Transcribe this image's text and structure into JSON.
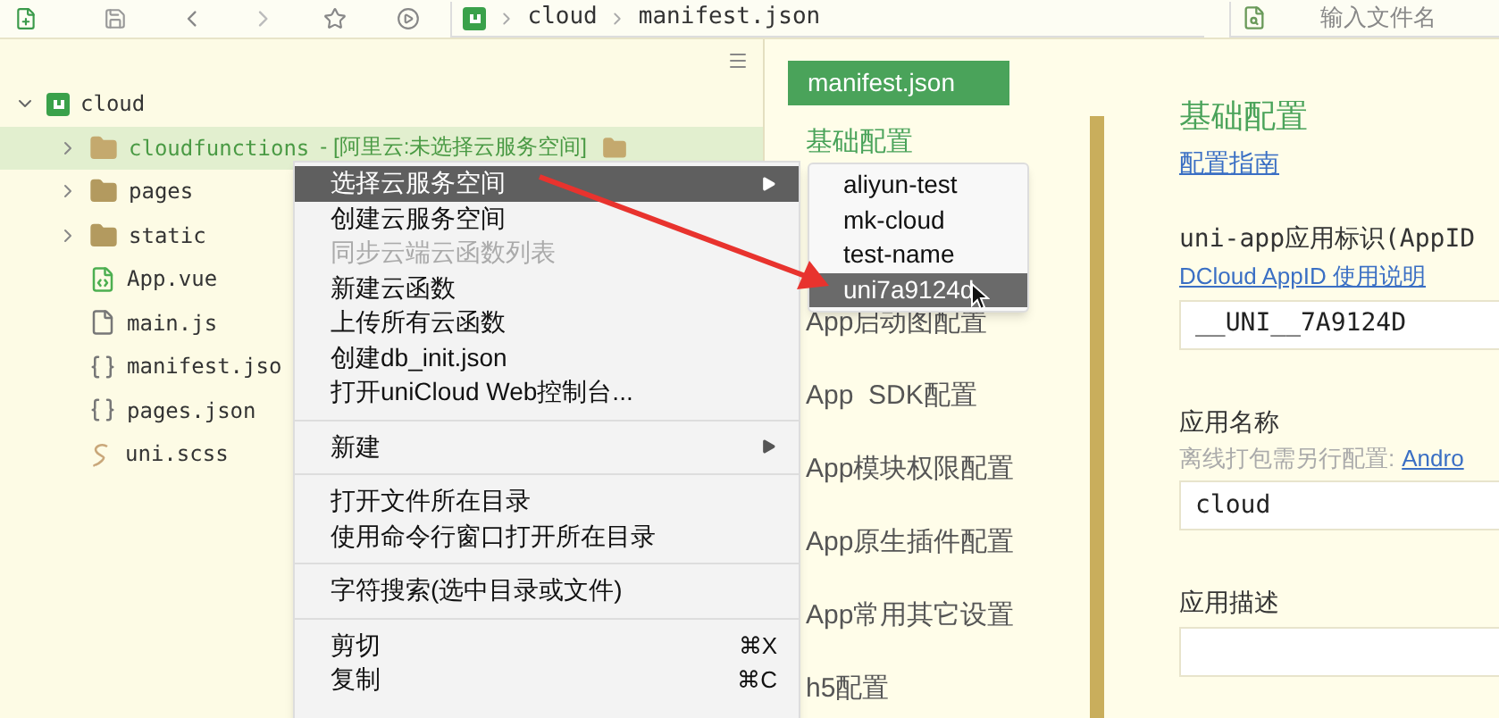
{
  "toolbar": {
    "breadcrumb": [
      "cloud",
      "manifest.json"
    ],
    "file_search": {
      "placeholder": "输入文件名"
    }
  },
  "project_tree": [
    {
      "label": "cloud",
      "kind": "project",
      "expanded": true,
      "selected": false,
      "children": [
        {
          "label": "cloudfunctions",
          "tag": "- [阿里云:未选择云服务空间]",
          "kind": "cloud-folder",
          "expanded": false,
          "selected": true
        },
        {
          "label": "pages",
          "kind": "folder",
          "expanded": false,
          "selected": false
        },
        {
          "label": "static",
          "kind": "folder",
          "expanded": false,
          "selected": false
        },
        {
          "label": "App.vue",
          "kind": "vue",
          "selected": false
        },
        {
          "label": "main.js",
          "kind": "js",
          "selected": false
        },
        {
          "label": "manifest.jso",
          "kind": "json",
          "selected": false
        },
        {
          "label": "pages.json",
          "kind": "json",
          "selected": false
        },
        {
          "label": "uni.scss",
          "kind": "scss",
          "selected": false
        }
      ]
    }
  ],
  "editor": {
    "tab": "manifest.json",
    "nav": [
      "基础配置",
      "App启动图配置",
      "App  SDK配置",
      "App模块权限配置",
      "App原生插件配置",
      "App常用其它设置",
      "h5配置"
    ],
    "title": "基础配置",
    "guide_link": "配置指南",
    "fields": [
      {
        "label": "uni-app应用标识(AppID",
        "link": "DCloud AppID 使用说明",
        "value": "__UNI__7A9124D"
      },
      {
        "label": "应用名称",
        "hint": "离线打包需另行配置:",
        "link": "Andro",
        "value": "cloud"
      },
      {
        "label": "应用描述"
      }
    ]
  },
  "context_menu": {
    "groups": [
      [
        {
          "label": "选择云服务空间",
          "submenu": true,
          "selected": true,
          "disabled": false
        },
        {
          "label": "创建云服务空间",
          "selected": false,
          "disabled": false
        },
        {
          "label": "同步云端云函数列表",
          "selected": false,
          "disabled": true
        },
        {
          "label": "新建云函数",
          "selected": false,
          "disabled": false
        },
        {
          "label": "上传所有云函数",
          "selected": false,
          "disabled": false
        },
        {
          "label": "创建db_init.json",
          "selected": false,
          "disabled": false
        },
        {
          "label": "打开uniCloud Web控制台...",
          "selected": false,
          "disabled": false
        }
      ],
      [
        {
          "label": "新建",
          "submenu": true,
          "selected": false,
          "disabled": false
        }
      ],
      [
        {
          "label": "打开文件所在目录",
          "selected": false,
          "disabled": false
        },
        {
          "label": "使用命令行窗口打开所在目录",
          "selected": false,
          "disabled": false
        }
      ],
      [
        {
          "label": "字符搜索(选中目录或文件)",
          "selected": false,
          "disabled": false
        }
      ],
      [
        {
          "label": "剪切",
          "shortcut": "⌘X",
          "selected": false,
          "disabled": false
        },
        {
          "label": "复制",
          "shortcut": "⌘C",
          "selected": false,
          "disabled": false
        }
      ]
    ]
  },
  "submenu": [
    {
      "label": "aliyun-test",
      "selected": false
    },
    {
      "label": "mk-cloud",
      "selected": false
    },
    {
      "label": "test-name",
      "selected": false
    },
    {
      "label": "uni7a9124d",
      "selected": true
    }
  ]
}
